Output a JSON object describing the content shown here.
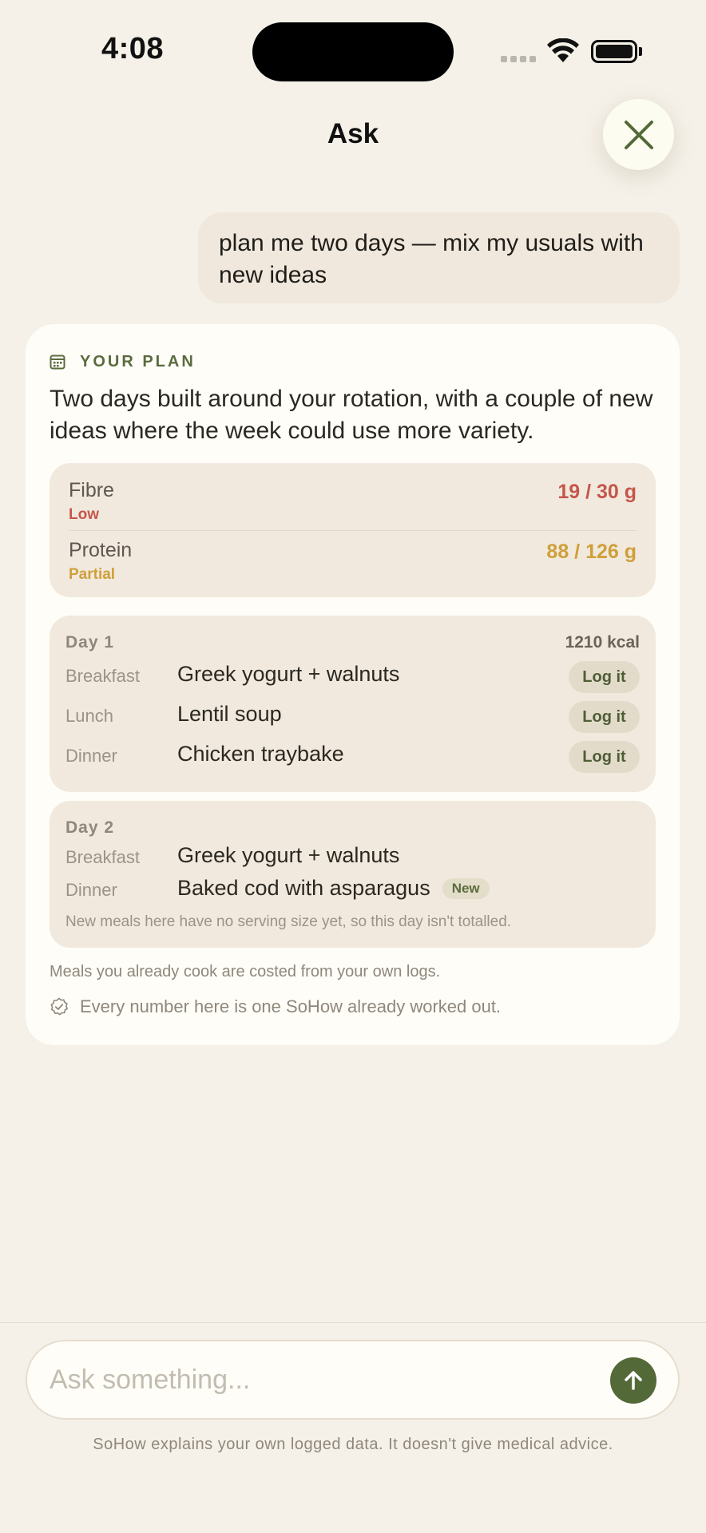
{
  "status_bar": {
    "time": "4:08"
  },
  "header": {
    "title": "Ask"
  },
  "chat": {
    "user_message": "plan me two days — mix my usuals with new ideas"
  },
  "plan": {
    "label": "YOUR PLAN",
    "summary": "Two days built around your rotation, with a couple of new ideas where the week could use more variety.",
    "nutrients": [
      {
        "name": "Fibre",
        "status": "Low",
        "value": "19 / 30 g",
        "color": "#c5564a"
      },
      {
        "name": "Protein",
        "status": "Partial",
        "value": "88 / 126 g",
        "color": "#cf9f3a"
      }
    ],
    "days": [
      {
        "label": "Day 1",
        "kcal": "1210 kcal",
        "meals": [
          {
            "slot": "Breakfast",
            "name": "Greek yogurt + walnuts",
            "action": "Log it"
          },
          {
            "slot": "Lunch",
            "name": "Lentil soup",
            "action": "Log it"
          },
          {
            "slot": "Dinner",
            "name": "Chicken traybake",
            "action": "Log it"
          }
        ]
      },
      {
        "label": "Day 2",
        "meals": [
          {
            "slot": "Breakfast",
            "name": "Greek yogurt + walnuts"
          },
          {
            "slot": "Dinner",
            "name": "Baked cod with asparagus",
            "badge": "New"
          }
        ],
        "note": "New meals here have no serving size yet, so this day isn't totalled."
      }
    ],
    "footnote": "Meals you already cook are costed from your own logs.",
    "verified_note": "Every number here is one SoHow already worked out."
  },
  "input": {
    "placeholder": "Ask something..."
  },
  "disclaimer": "SoHow explains your own logged data. It doesn't give medical advice.",
  "colors": {
    "accent": "#536a38",
    "background": "#f5f1e9",
    "card": "#fefdf8",
    "inner_box": "#f1e9dd"
  }
}
